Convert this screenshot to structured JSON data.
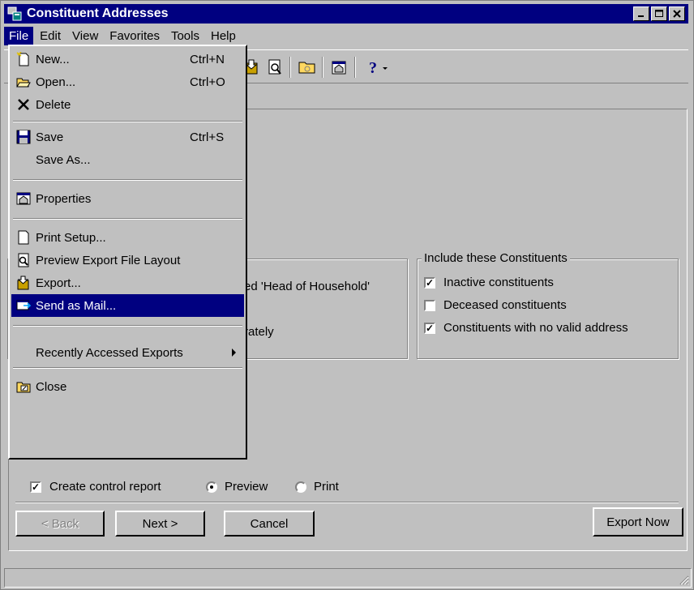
{
  "window": {
    "title": "Constituent Addresses",
    "controls": {
      "minimize": "_",
      "maximize": "□",
      "close": "X"
    }
  },
  "menubar": {
    "items": [
      "File",
      "Edit",
      "View",
      "Favorites",
      "Tools",
      "Help"
    ]
  },
  "file_menu": {
    "new": {
      "label": "New...",
      "shortcut": "Ctrl+N"
    },
    "open": {
      "label": "Open...",
      "shortcut": "Ctrl+O"
    },
    "delete": {
      "label": "Delete"
    },
    "save": {
      "label": "Save",
      "shortcut": "Ctrl+S"
    },
    "save_as": {
      "label": "Save As..."
    },
    "properties": {
      "label": "Properties"
    },
    "print_setup": {
      "label": "Print Setup..."
    },
    "preview_layout": {
      "label": "Preview Export File Layout"
    },
    "export": {
      "label": "Export..."
    },
    "send_mail": {
      "label": "Send as Mail..."
    },
    "recent": {
      "label": "Recently Accessed Exports"
    },
    "close": {
      "label": "Close"
    }
  },
  "panel": {
    "partial_text_1": "ed 'Head of Household'",
    "partial_text_2": "rately",
    "include_group": {
      "title": "Include these Constituents",
      "options": [
        {
          "label": "Inactive constituents",
          "checked": true
        },
        {
          "label": "Deceased constituents",
          "checked": false
        },
        {
          "label": "Constituents with no valid address",
          "checked": true
        }
      ]
    },
    "control_report": {
      "label": "Create control report",
      "checked": true
    },
    "output": {
      "preview": "Preview",
      "print": "Print",
      "selected": "preview"
    }
  },
  "buttons": {
    "back": "< Back",
    "next": "Next >",
    "cancel": "Cancel",
    "export_now": "Export Now"
  },
  "colors": {
    "face": "#c0c0c0",
    "title": "#000080",
    "highlight": "#000080"
  }
}
